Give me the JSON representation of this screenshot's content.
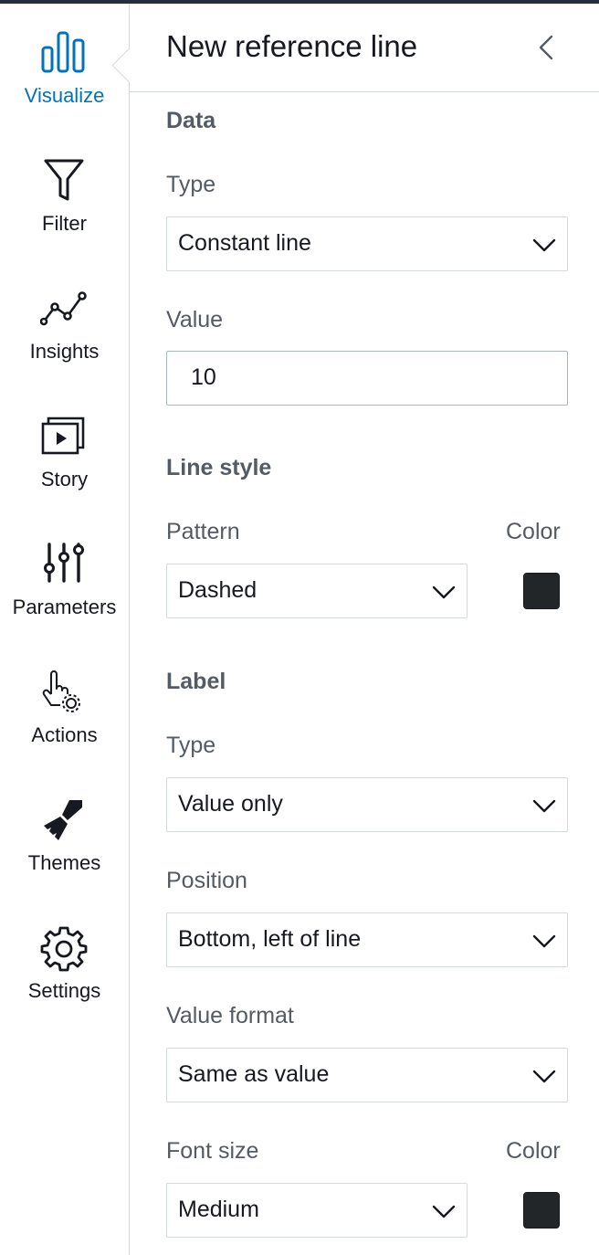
{
  "sidebar": {
    "items": [
      {
        "label": "Visualize",
        "icon": "bar-chart-icon",
        "active": true
      },
      {
        "label": "Filter",
        "icon": "filter-icon"
      },
      {
        "label": "Insights",
        "icon": "line-insight-icon"
      },
      {
        "label": "Story",
        "icon": "story-play-icon"
      },
      {
        "label": "Parameters",
        "icon": "sliders-icon"
      },
      {
        "label": "Actions",
        "icon": "pointer-gear-icon"
      },
      {
        "label": "Themes",
        "icon": "paint-brush-icon"
      },
      {
        "label": "Settings",
        "icon": "gear-icon"
      }
    ]
  },
  "panel": {
    "title": "New reference line",
    "collapse_icon": "chevron-left-icon",
    "data_section": {
      "title": "Data",
      "type_label": "Type",
      "type_value": "Constant line",
      "value_label": "Value",
      "value_value": "10"
    },
    "line_style_section": {
      "title": "Line style",
      "pattern_label": "Pattern",
      "pattern_value": "Dashed",
      "color_label": "Color",
      "color_value": "#232629"
    },
    "label_section": {
      "title": "Label",
      "type_label": "Type",
      "type_value": "Value only",
      "position_label": "Position",
      "position_value": "Bottom, left of line",
      "value_format_label": "Value format",
      "value_format_value": "Same as value",
      "font_size_label": "Font size",
      "font_size_value": "Medium",
      "color_label": "Color",
      "color_value": "#232629"
    }
  },
  "colors": {
    "accent": "#0073bb",
    "text": "#16191f",
    "muted": "#545b64",
    "border": "#d5dbdb"
  }
}
